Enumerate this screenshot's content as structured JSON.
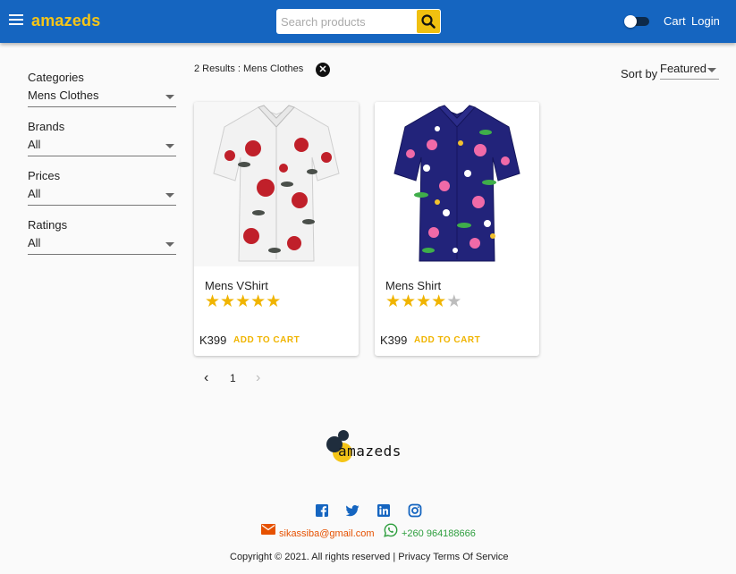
{
  "header": {
    "brand": "amazeds",
    "search_placeholder": "Search products",
    "cart_label": "Cart",
    "login_label": "Login"
  },
  "filters": [
    {
      "label": "Categories",
      "value": "Mens Clothes"
    },
    {
      "label": "Brands",
      "value": "All"
    },
    {
      "label": "Prices",
      "value": "All"
    },
    {
      "label": "Ratings",
      "value": "All"
    }
  ],
  "results": {
    "summary": "2 Results : Mens Clothes",
    "sort_label": "Sort by",
    "sort_value": "Featured"
  },
  "products": [
    {
      "name": "Mens VShirt",
      "rating": 5,
      "max_rating": 5,
      "price": "K399",
      "cta": "ADD TO CART"
    },
    {
      "name": "Mens Shirt",
      "rating": 4,
      "max_rating": 5,
      "price": "K399",
      "cta": "ADD TO CART"
    }
  ],
  "pagination": {
    "prev": "‹",
    "current": "1",
    "next": "›"
  },
  "footer": {
    "logo_text": "amazeds",
    "email": "sikassiba@gmail.com",
    "phone": "+260 964188666",
    "copyright": "Copyright © 2021. All rights reserved | Privacy Terms Of Service"
  },
  "colors": {
    "appbar": "#1565c0",
    "brand": "#f5c518",
    "star_on": "#f0b400",
    "star_off": "#bdbdbd",
    "email": "#e65100",
    "whatsapp": "#2e9e3e",
    "social": "#1565c0"
  },
  "icons": [
    "menu-icon",
    "search-icon",
    "close-icon",
    "chevron-left-icon",
    "chevron-right-icon",
    "facebook-icon",
    "twitter-icon",
    "linkedin-icon",
    "instagram-icon",
    "email-icon",
    "whatsapp-icon"
  ]
}
